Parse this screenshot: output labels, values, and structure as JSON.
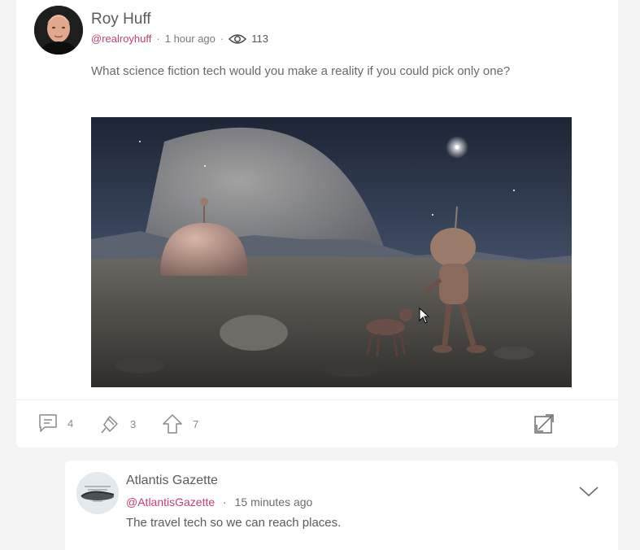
{
  "post": {
    "author_name": "Roy Huff",
    "handle": "@realroyhuff",
    "separator": "·",
    "time": "1 hour ago",
    "views": "113",
    "text": "What science fiction tech would you make a reality if you could pick only one?",
    "image_icon": "space-scene-image"
  },
  "actions": {
    "comments": "4",
    "reposts": "3",
    "upvotes": "7"
  },
  "reply": {
    "author_name": "Atlantis Gazette",
    "handle": "@AtlantisGazette",
    "separator": "·",
    "time": "15 minutes ago",
    "text": "The travel tech so we can reach places."
  },
  "colors": {
    "handle": "#c2407a",
    "background": "#f3f3f3",
    "card": "#ffffff"
  }
}
